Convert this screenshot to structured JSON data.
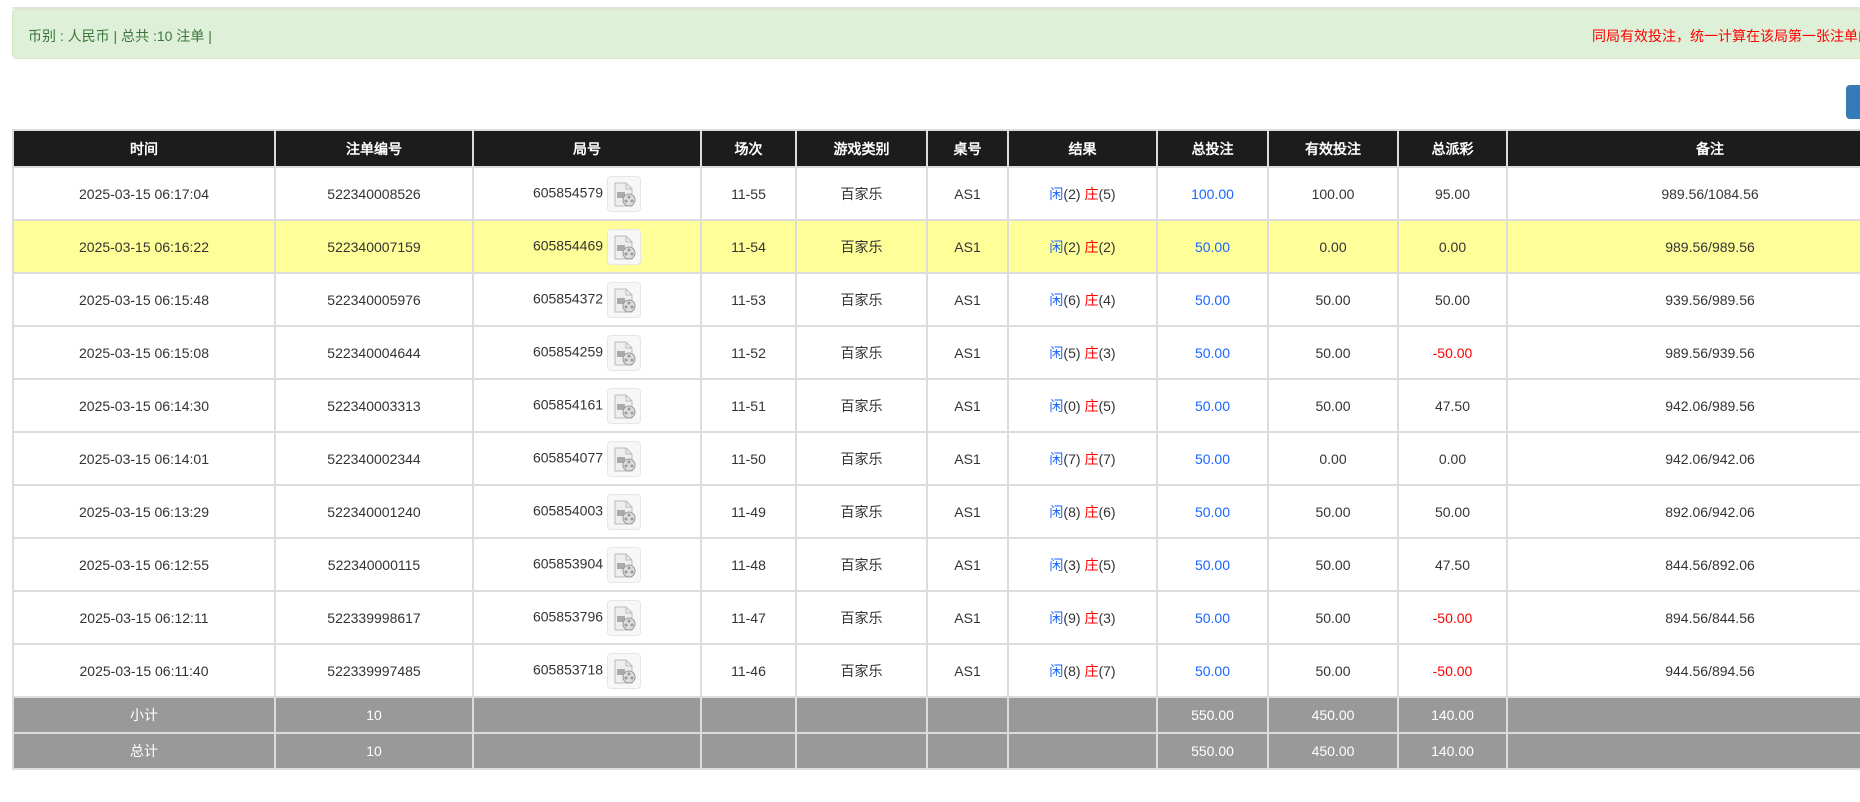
{
  "summary": {
    "left": "币别 : 人民币 | 总共 :10 注单 |",
    "right": "同局有效投注，统一计算在该局第一张注单内"
  },
  "colors": {
    "header_bg": "#1c1c1c",
    "highlight": "#ffff99",
    "footer_bg": "#999999",
    "player": "#1a66ff",
    "banker": "#ff0000",
    "alert_bg": "#dff0d8",
    "button": "#337ab7"
  },
  "table": {
    "headers": [
      "时间",
      "注单编号",
      "局号",
      "场次",
      "游戏类别",
      "桌号",
      "结果",
      "总投注",
      "有效投注",
      "总派彩",
      "备注"
    ],
    "player_label": "闲",
    "banker_label": "庄",
    "rows": [
      {
        "time": "2025-03-15 06:17:04",
        "bet_id": "522340008526",
        "round": "605854579",
        "session": "11-55",
        "game": "百家乐",
        "table": "AS1",
        "player": "(2)",
        "banker": "(5)",
        "total": "100.00",
        "valid": "100.00",
        "payout": "95.00",
        "payout_negative": false,
        "note": "989.56/1084.56",
        "highlight": false
      },
      {
        "time": "2025-03-15 06:16:22",
        "bet_id": "522340007159",
        "round": "605854469",
        "session": "11-54",
        "game": "百家乐",
        "table": "AS1",
        "player": "(2)",
        "banker": "(2)",
        "total": "50.00",
        "valid": "0.00",
        "payout": "0.00",
        "payout_negative": false,
        "note": "989.56/989.56",
        "highlight": true
      },
      {
        "time": "2025-03-15 06:15:48",
        "bet_id": "522340005976",
        "round": "605854372",
        "session": "11-53",
        "game": "百家乐",
        "table": "AS1",
        "player": "(6)",
        "banker": "(4)",
        "total": "50.00",
        "valid": "50.00",
        "payout": "50.00",
        "payout_negative": false,
        "note": "939.56/989.56",
        "highlight": false
      },
      {
        "time": "2025-03-15 06:15:08",
        "bet_id": "522340004644",
        "round": "605854259",
        "session": "11-52",
        "game": "百家乐",
        "table": "AS1",
        "player": "(5)",
        "banker": "(3)",
        "total": "50.00",
        "valid": "50.00",
        "payout": "-50.00",
        "payout_negative": true,
        "note": "989.56/939.56",
        "highlight": false
      },
      {
        "time": "2025-03-15 06:14:30",
        "bet_id": "522340003313",
        "round": "605854161",
        "session": "11-51",
        "game": "百家乐",
        "table": "AS1",
        "player": "(0)",
        "banker": "(5)",
        "total": "50.00",
        "valid": "50.00",
        "payout": "47.50",
        "payout_negative": false,
        "note": "942.06/989.56",
        "highlight": false
      },
      {
        "time": "2025-03-15 06:14:01",
        "bet_id": "522340002344",
        "round": "605854077",
        "session": "11-50",
        "game": "百家乐",
        "table": "AS1",
        "player": "(7)",
        "banker": "(7)",
        "total": "50.00",
        "valid": "0.00",
        "payout": "0.00",
        "payout_negative": false,
        "note": "942.06/942.06",
        "highlight": false
      },
      {
        "time": "2025-03-15 06:13:29",
        "bet_id": "522340001240",
        "round": "605854003",
        "session": "11-49",
        "game": "百家乐",
        "table": "AS1",
        "player": "(8)",
        "banker": "(6)",
        "total": "50.00",
        "valid": "50.00",
        "payout": "50.00",
        "payout_negative": false,
        "note": "892.06/942.06",
        "highlight": false
      },
      {
        "time": "2025-03-15 06:12:55",
        "bet_id": "522340000115",
        "round": "605853904",
        "session": "11-48",
        "game": "百家乐",
        "table": "AS1",
        "player": "(3)",
        "banker": "(5)",
        "total": "50.00",
        "valid": "50.00",
        "payout": "47.50",
        "payout_negative": false,
        "note": "844.56/892.06",
        "highlight": false
      },
      {
        "time": "2025-03-15 06:12:11",
        "bet_id": "522339998617",
        "round": "605853796",
        "session": "11-47",
        "game": "百家乐",
        "table": "AS1",
        "player": "(9)",
        "banker": "(3)",
        "total": "50.00",
        "valid": "50.00",
        "payout": "-50.00",
        "payout_negative": true,
        "note": "894.56/844.56",
        "highlight": false
      },
      {
        "time": "2025-03-15 06:11:40",
        "bet_id": "522339997485",
        "round": "605853718",
        "session": "11-46",
        "game": "百家乐",
        "table": "AS1",
        "player": "(8)",
        "banker": "(7)",
        "total": "50.00",
        "valid": "50.00",
        "payout": "-50.00",
        "payout_negative": true,
        "note": "944.56/894.56",
        "highlight": false
      }
    ],
    "footer": [
      {
        "label": "小计",
        "count": "10",
        "total": "550.00",
        "valid": "450.00",
        "payout": "140.00"
      },
      {
        "label": "总计",
        "count": "10",
        "total": "550.00",
        "valid": "450.00",
        "payout": "140.00"
      }
    ]
  }
}
